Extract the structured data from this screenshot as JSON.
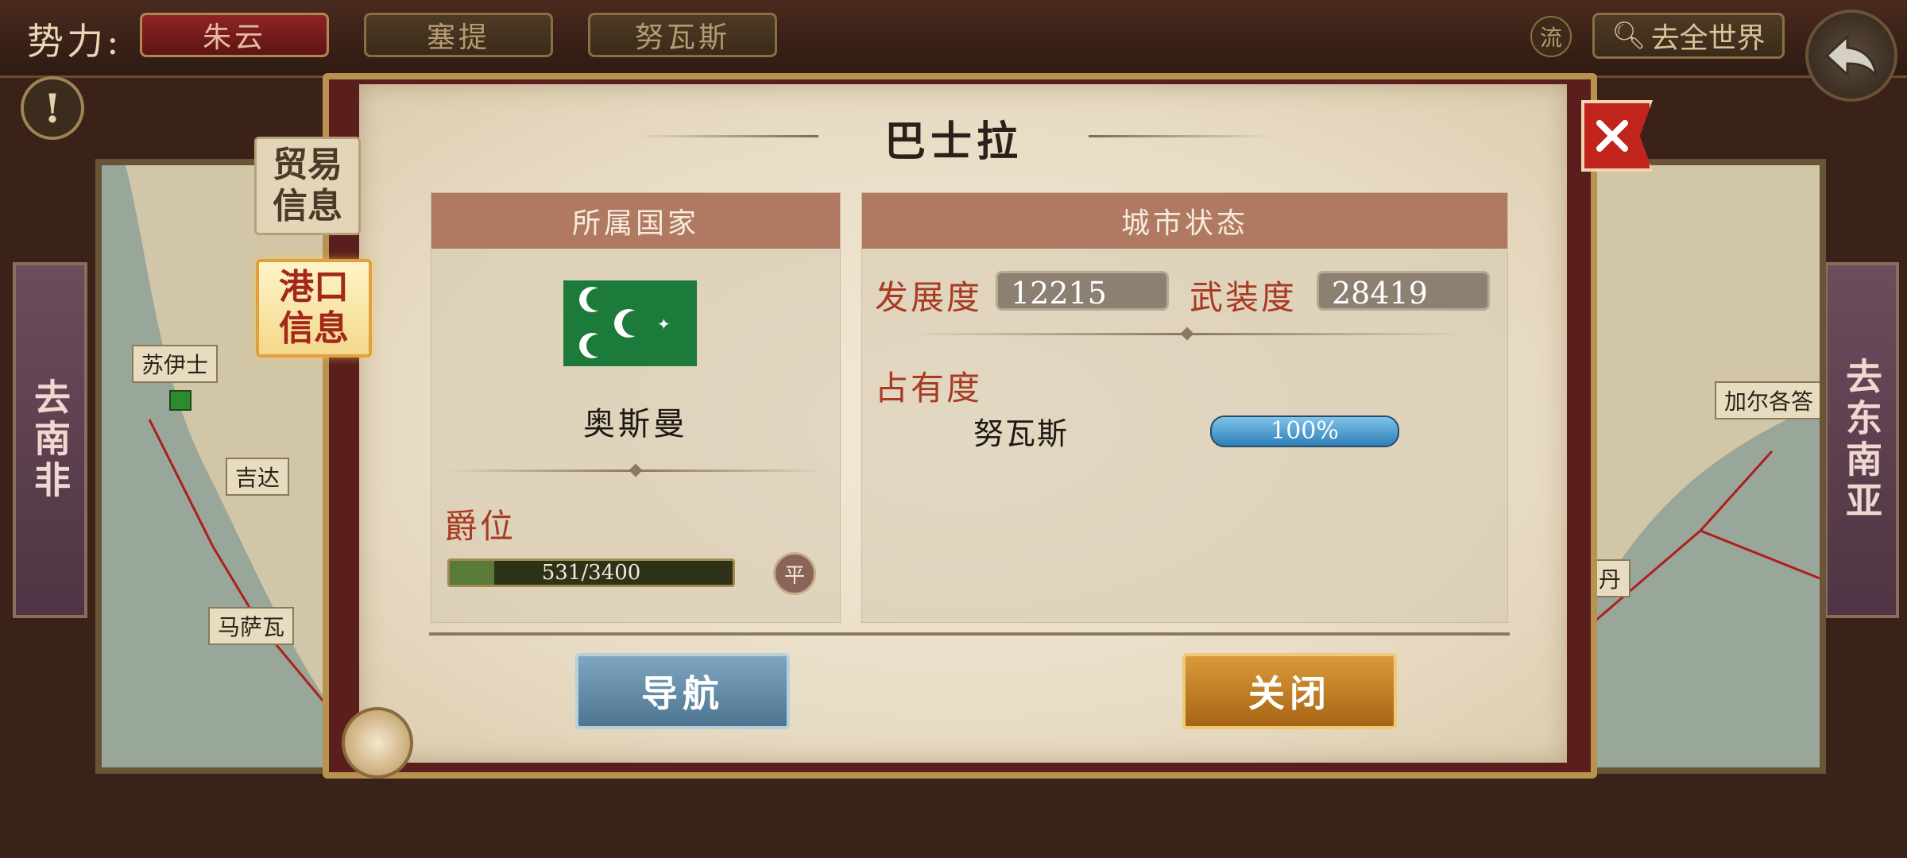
{
  "top_bar": {
    "faction_label": "势力:",
    "factions": [
      "朱云",
      "塞提",
      "努瓦斯"
    ],
    "active_faction": "朱云",
    "flow_label": "流",
    "world_button": "去全世界"
  },
  "side_nav": {
    "left": "去南非",
    "right": "去东南亚"
  },
  "map_labels": {
    "left": [
      "苏伊士",
      "吉达",
      "马萨瓦"
    ],
    "right": [
      "加尔各答",
      "丹"
    ]
  },
  "tabs": {
    "trade": "贸易信息",
    "port": "港口信息"
  },
  "dialog": {
    "title": "巴士拉",
    "country_panel": {
      "header": "所属国家",
      "country_name": "奥斯曼",
      "rank_label": "爵位",
      "rank_progress": "531/3400",
      "rank_fraction": 0.156,
      "peace_badge": "平"
    },
    "city_panel": {
      "header": "城市状态",
      "development_label": "发展度",
      "development_value": "12215",
      "armament_label": "武装度",
      "armament_value": "28419",
      "occupancy_label": "占有度",
      "occupancy": [
        {
          "name": "努瓦斯",
          "percent": "100%"
        }
      ]
    },
    "buttons": {
      "navigate": "导航",
      "close": "关闭"
    }
  },
  "colors": {
    "accent_red": "#a83a22",
    "panel_header": "#b07a62",
    "nav_button": "#5d86a2",
    "close_button": "#c07a22",
    "flag_green": "#1c7a3a"
  }
}
